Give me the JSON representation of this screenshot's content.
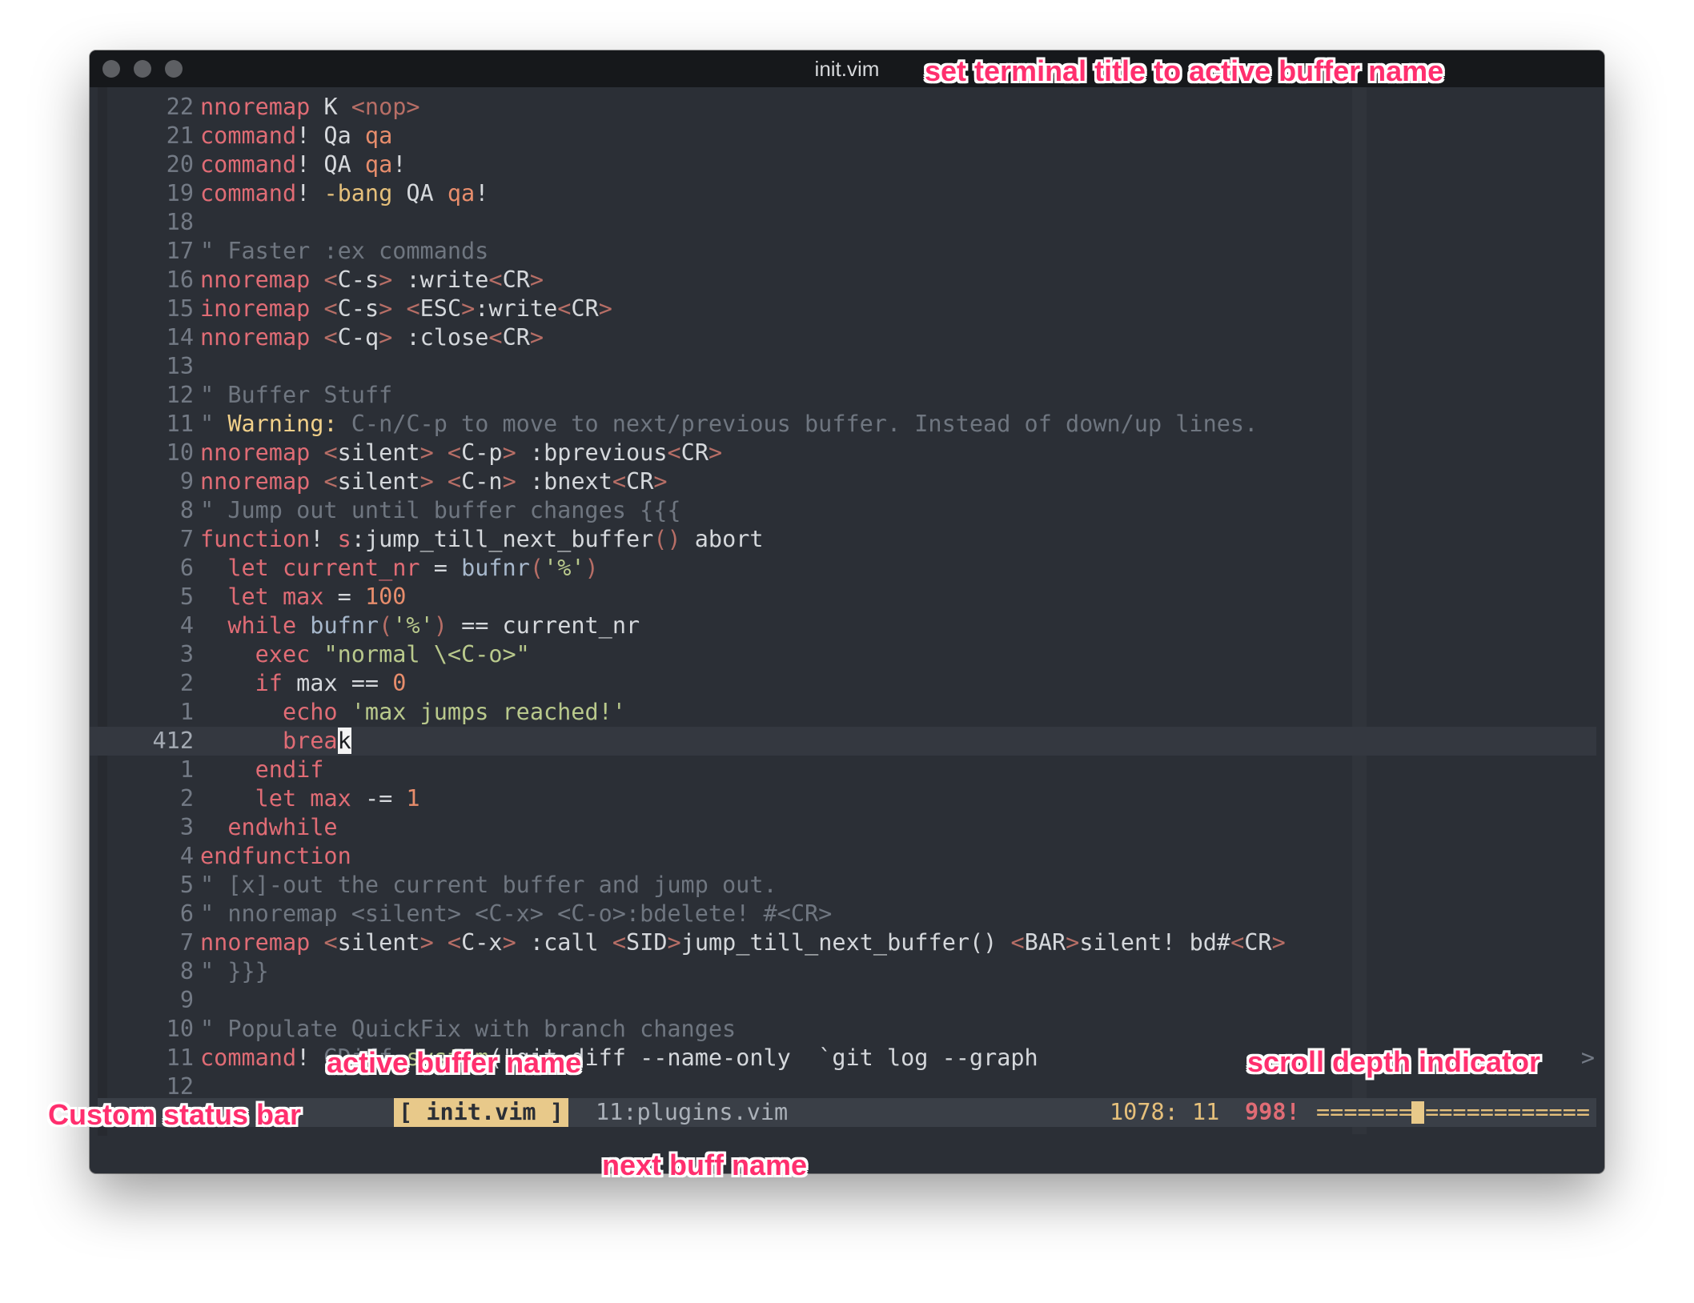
{
  "window": {
    "title": "init.vim"
  },
  "editor": {
    "lines": [
      {
        "num": "22",
        "tokens": [
          [
            "kw",
            "nnoremap"
          ],
          [
            "op",
            " K "
          ],
          [
            "br",
            "<nop>"
          ]
        ]
      },
      {
        "num": "21",
        "tokens": [
          [
            "kw",
            "command"
          ],
          [
            "op",
            "! Qa "
          ],
          [
            "qa",
            "qa"
          ]
        ]
      },
      {
        "num": "20",
        "tokens": [
          [
            "kw",
            "command"
          ],
          [
            "op",
            "! QA "
          ],
          [
            "qa",
            "qa"
          ],
          [
            "op",
            "!"
          ]
        ]
      },
      {
        "num": "19",
        "tokens": [
          [
            "kw",
            "command"
          ],
          [
            "op",
            "! "
          ],
          [
            "bang",
            "-bang"
          ],
          [
            "op",
            " QA "
          ],
          [
            "qa",
            "qa"
          ],
          [
            "op",
            "!"
          ]
        ]
      },
      {
        "num": "18",
        "tokens": []
      },
      {
        "num": "17",
        "tokens": [
          [
            "cmt",
            "\" Faster :ex commands"
          ]
        ]
      },
      {
        "num": "16",
        "tokens": [
          [
            "kw",
            "nnoremap"
          ],
          [
            "op",
            " "
          ],
          [
            "br",
            "<"
          ],
          [
            "op",
            "C-s"
          ],
          [
            "br",
            ">"
          ],
          [
            "op",
            " :write"
          ],
          [
            "br",
            "<"
          ],
          [
            "op",
            "CR"
          ],
          [
            "br",
            ">"
          ]
        ]
      },
      {
        "num": "15",
        "tokens": [
          [
            "kw",
            "inoremap"
          ],
          [
            "op",
            " "
          ],
          [
            "br",
            "<"
          ],
          [
            "op",
            "C-s"
          ],
          [
            "br",
            ">"
          ],
          [
            "op",
            " "
          ],
          [
            "br",
            "<"
          ],
          [
            "op",
            "ESC"
          ],
          [
            "br",
            ">"
          ],
          [
            "op",
            ":write"
          ],
          [
            "br",
            "<"
          ],
          [
            "op",
            "CR"
          ],
          [
            "br",
            ">"
          ]
        ]
      },
      {
        "num": "14",
        "tokens": [
          [
            "kw",
            "nnoremap"
          ],
          [
            "op",
            " "
          ],
          [
            "br",
            "<"
          ],
          [
            "op",
            "C-q"
          ],
          [
            "br",
            ">"
          ],
          [
            "op",
            " :close"
          ],
          [
            "br",
            "<"
          ],
          [
            "op",
            "CR"
          ],
          [
            "br",
            ">"
          ]
        ]
      },
      {
        "num": "13",
        "tokens": []
      },
      {
        "num": "12",
        "tokens": [
          [
            "cmt",
            "\" Buffer Stuff"
          ]
        ]
      },
      {
        "num": "11",
        "tokens": [
          [
            "cmt",
            "\" "
          ],
          [
            "warn",
            "Warning:"
          ],
          [
            "cmt",
            " C-n/C-p to move to next/previous buffer. Instead of down/up lines."
          ]
        ]
      },
      {
        "num": "10",
        "tokens": [
          [
            "kw",
            "nnoremap"
          ],
          [
            "op",
            " "
          ],
          [
            "br",
            "<"
          ],
          [
            "op",
            "silent"
          ],
          [
            "br",
            ">"
          ],
          [
            "op",
            " "
          ],
          [
            "br",
            "<"
          ],
          [
            "op",
            "C-p"
          ],
          [
            "br",
            ">"
          ],
          [
            "op",
            " :bprevious"
          ],
          [
            "br",
            "<"
          ],
          [
            "op",
            "CR"
          ],
          [
            "br",
            ">"
          ]
        ]
      },
      {
        "num": "9",
        "tokens": [
          [
            "kw",
            "nnoremap"
          ],
          [
            "op",
            " "
          ],
          [
            "br",
            "<"
          ],
          [
            "op",
            "silent"
          ],
          [
            "br",
            ">"
          ],
          [
            "op",
            " "
          ],
          [
            "br",
            "<"
          ],
          [
            "op",
            "C-n"
          ],
          [
            "br",
            ">"
          ],
          [
            "op",
            " :bnext"
          ],
          [
            "br",
            "<"
          ],
          [
            "op",
            "CR"
          ],
          [
            "br",
            ">"
          ]
        ]
      },
      {
        "num": "8",
        "tokens": [
          [
            "cmt",
            "\" Jump out until buffer changes {{{"
          ]
        ]
      },
      {
        "num": "7",
        "tokens": [
          [
            "kw",
            "function"
          ],
          [
            "op",
            "! "
          ],
          [
            "kw",
            "s"
          ],
          [
            "op",
            ":jump_till_next_buffer"
          ],
          [
            "br",
            "()"
          ],
          [
            "op",
            " abort"
          ]
        ]
      },
      {
        "num": "6",
        "tokens": [
          [
            "op",
            "  "
          ],
          [
            "kw",
            "let"
          ],
          [
            "op",
            " "
          ],
          [
            "var",
            "current_nr"
          ],
          [
            "op",
            " = "
          ],
          [
            "fn",
            "bufnr"
          ],
          [
            "br",
            "("
          ],
          [
            "str",
            "'%'"
          ],
          [
            "br",
            ")"
          ]
        ]
      },
      {
        "num": "5",
        "tokens": [
          [
            "op",
            "  "
          ],
          [
            "kw",
            "let"
          ],
          [
            "op",
            " "
          ],
          [
            "var",
            "max"
          ],
          [
            "op",
            " = "
          ],
          [
            "num",
            "100"
          ]
        ]
      },
      {
        "num": "4",
        "tokens": [
          [
            "op",
            "  "
          ],
          [
            "kw",
            "while"
          ],
          [
            "op",
            " "
          ],
          [
            "fn",
            "bufnr"
          ],
          [
            "br",
            "("
          ],
          [
            "str",
            "'%'"
          ],
          [
            "br",
            ")"
          ],
          [
            "op",
            " == current_nr"
          ]
        ]
      },
      {
        "num": "3",
        "tokens": [
          [
            "op",
            "    "
          ],
          [
            "kw",
            "exec"
          ],
          [
            "op",
            " "
          ],
          [
            "str",
            "\"normal \\<C-o>\""
          ]
        ]
      },
      {
        "num": "2",
        "tokens": [
          [
            "op",
            "    "
          ],
          [
            "kw",
            "if"
          ],
          [
            "op",
            " max == "
          ],
          [
            "num",
            "0"
          ]
        ]
      },
      {
        "num": "1",
        "tokens": [
          [
            "op",
            "      "
          ],
          [
            "kw",
            "echo"
          ],
          [
            "op",
            " "
          ],
          [
            "str",
            "'max jumps reached!'"
          ]
        ]
      },
      {
        "num": "412",
        "current": true,
        "tokens": [
          [
            "op",
            "      "
          ],
          [
            "kw",
            "brea"
          ],
          [
            "cursor",
            "k"
          ]
        ]
      },
      {
        "num": "1",
        "tokens": [
          [
            "op",
            "    "
          ],
          [
            "kw",
            "endif"
          ]
        ]
      },
      {
        "num": "2",
        "tokens": [
          [
            "op",
            "    "
          ],
          [
            "kw",
            "let"
          ],
          [
            "op",
            " "
          ],
          [
            "var",
            "max"
          ],
          [
            "op",
            " -= "
          ],
          [
            "num",
            "1"
          ]
        ]
      },
      {
        "num": "3",
        "tokens": [
          [
            "op",
            "  "
          ],
          [
            "kw",
            "endwhile"
          ]
        ]
      },
      {
        "num": "4",
        "tokens": [
          [
            "kw",
            "endfunction"
          ]
        ]
      },
      {
        "num": "5",
        "tokens": [
          [
            "cmt",
            "\" [x]-out the current buffer and jump out."
          ]
        ]
      },
      {
        "num": "6",
        "tokens": [
          [
            "cmt",
            "\" nnoremap <silent> <C-x> <C-o>:bdelete! #<CR>"
          ]
        ]
      },
      {
        "num": "7",
        "tokens": [
          [
            "kw",
            "nnoremap"
          ],
          [
            "op",
            " "
          ],
          [
            "br",
            "<"
          ],
          [
            "op",
            "silent"
          ],
          [
            "br",
            ">"
          ],
          [
            "op",
            " "
          ],
          [
            "br",
            "<"
          ],
          [
            "op",
            "C-x"
          ],
          [
            "br",
            ">"
          ],
          [
            "op",
            " :call "
          ],
          [
            "br",
            "<"
          ],
          [
            "op",
            "SID"
          ],
          [
            "br",
            ">"
          ],
          [
            "op",
            "jump_till_next_buffer() "
          ],
          [
            "br",
            "<"
          ],
          [
            "op",
            "BAR"
          ],
          [
            "br",
            ">"
          ],
          [
            "op",
            "silent! bd#"
          ],
          [
            "br",
            "<"
          ],
          [
            "op",
            "CR"
          ],
          [
            "br",
            ">"
          ]
        ]
      },
      {
        "num": "8",
        "tokens": [
          [
            "cmt",
            "\" }}}"
          ]
        ]
      },
      {
        "num": "9",
        "tokens": []
      },
      {
        "num": "10",
        "tokens": [
          [
            "cmt",
            "\" Populate QuickFix with branch changes"
          ]
        ]
      },
      {
        "num": "11",
        "tail": ">",
        "tokens": [
          [
            "kw",
            "command"
          ],
          [
            "op",
            "! "
          ],
          [
            "cmt",
            "GDiff"
          ],
          [
            "op",
            " "
          ],
          [
            "str",
            "system"
          ],
          [
            "op",
            "(\"git diff --name-only  `git log --graph"
          ]
        ]
      },
      {
        "num": "12",
        "tokens": []
      }
    ]
  },
  "statusbar": {
    "active_buffer": "[ init.vim ]",
    "next_buffer": "11:plugins.vim",
    "position": "1078: 11",
    "warnings": "998!",
    "scroll_left": "=======",
    "scroll_right": "============",
    "scroll_depth": 0.37
  },
  "annotations": {
    "title": "set terminal title to active buffer name",
    "active_buffer": "active buffer name",
    "scroll_depth": "scroll depth indicator",
    "status_bar": "Custom status bar",
    "next_buffer": "next buff name"
  },
  "colors": {
    "background": "#2b2f36",
    "keyword": "#e06c75",
    "string": "#b9c98c",
    "comment": "#6f7680",
    "status_active": "#e8c98a",
    "annotation": "#ff2f6e"
  }
}
